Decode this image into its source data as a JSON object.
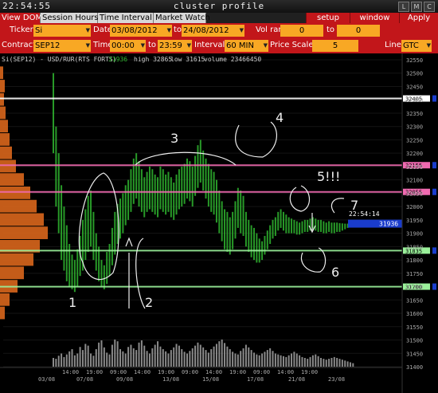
{
  "window": {
    "clock": "22:54:55",
    "title": "cluster profile",
    "buttons": [
      "L",
      "M",
      "C"
    ]
  },
  "menu": {
    "tabs": [
      "View DOM",
      "Session Hours",
      "Time Interval",
      "Market Watch"
    ],
    "active_tab": "View DOM",
    "setup_label": "setup",
    "window_label": "window",
    "apply_label": "Apply"
  },
  "controls": {
    "ticker_label": "Ticker",
    "ticker_value": "Si",
    "date_label": "Date",
    "date_from": "03/08/2012",
    "to_label": "to",
    "date_to": "24/08/2012",
    "vol_range_label": "Vol range",
    "vol_from": "0",
    "vol_to_label": "to",
    "vol_to": "0",
    "contract_label": "Contract",
    "contract_value": "SEP12",
    "time_label": "Time",
    "time_from": "00:00",
    "time_to_label": "to",
    "time_to": "23:59",
    "interval_label": "Interval",
    "interval_value": "60 MIN",
    "price_scale_label": "Price Scale",
    "price_scale_value": "5",
    "line_label": "Line",
    "line_value": "GTC"
  },
  "colors": {
    "accent_red": "#c2161a",
    "field_orange": "#f8a824",
    "profile_orange": "#d9661c",
    "cluster_green": "#2fb52f",
    "last_price_blue": "#1a3ccc"
  },
  "chart_data": {
    "type": "cluster",
    "instrument": "Si(SEP12) - USD/RUR(RTS FORTS)",
    "last": "31936",
    "high_text": "high 32865",
    "low_text": "low 31615",
    "volume_text": "volume 23466450",
    "last_time": "22:54:14",
    "last_price": 31936,
    "ylim": [
      31400,
      32550
    ],
    "y_ticks": [
      32550,
      32500,
      32450,
      32400,
      32350,
      32300,
      32250,
      32200,
      32150,
      32100,
      32050,
      32000,
      31950,
      31900,
      31850,
      31800,
      31750,
      31700,
      31650,
      31600,
      31550,
      31500,
      31450,
      31400
    ],
    "x_ticks_top": [
      "14:00",
      "19:00",
      "09:00",
      "14:00",
      "19:00",
      "09:00",
      "14:00",
      "19:00",
      "09:00",
      "14:00",
      "19:00"
    ],
    "x_ticks_bottom": [
      "03/08",
      "07/08",
      "09/08",
      "13/08",
      "15/08",
      "17/08",
      "21/08",
      "23/08"
    ],
    "levels": [
      {
        "price": 32405,
        "label": "32405",
        "color": "#ffffff"
      },
      {
        "price": 32155,
        "label": "32155",
        "color": "#f06ab0"
      },
      {
        "price": 32055,
        "label": "32055",
        "color": "#f06ab0"
      },
      {
        "price": 31835,
        "label": "31835",
        "color": "#9af09a"
      },
      {
        "price": 31700,
        "label": "31700",
        "color": "#9af09a"
      }
    ],
    "cluster_x": [
      0,
      3,
      6,
      9,
      12,
      15,
      18,
      21,
      24,
      27,
      30,
      33,
      36,
      39,
      42,
      45,
      48,
      51,
      54,
      57,
      60,
      63,
      66,
      69,
      72,
      75,
      78,
      81,
      84,
      87,
      90,
      93,
      96,
      99,
      102,
      105,
      108,
      111,
      114,
      117,
      120,
      123,
      126,
      129,
      132,
      135,
      138,
      141,
      144,
      147,
      150,
      153,
      156,
      159,
      162,
      165,
      168,
      171,
      174,
      177,
      180,
      183,
      186,
      189,
      192,
      195,
      198,
      201,
      204,
      207,
      210,
      213,
      216,
      219,
      222,
      225,
      228,
      231,
      234,
      237,
      240,
      243,
      246,
      249,
      252,
      255,
      258,
      261,
      264,
      267,
      270,
      273,
      276,
      279,
      282,
      285,
      288,
      291,
      294,
      297,
      300,
      303,
      306,
      309,
      312,
      315,
      318,
      321,
      324,
      327,
      330,
      333,
      336
    ],
    "cluster_highs": [
      32500,
      32300,
      32200,
      32080,
      32000,
      31930,
      31860,
      31820,
      31800,
      31840,
      31890,
      31950,
      31990,
      32040,
      32060,
      31980,
      31900,
      31850,
      31800,
      31780,
      31830,
      31860,
      31920,
      31980,
      32010,
      32030,
      32050,
      32080,
      32100,
      32140,
      32180,
      32200,
      32170,
      32140,
      32110,
      32130,
      32150,
      32140,
      32120,
      32110,
      32150,
      32140,
      32120,
      32130,
      32110,
      32090,
      32120,
      32140,
      32150,
      32160,
      32180,
      32170,
      32150,
      32190,
      32230,
      32250,
      32210,
      32180,
      32160,
      32140,
      32130,
      32100,
      32060,
      32020,
      31990,
      31980,
      31960,
      31980,
      32020,
      32070,
      32060,
      32040,
      31980,
      31950,
      31930,
      31920,
      31900,
      31880,
      31870,
      31890,
      31910,
      31930,
      31950,
      31960,
      31980,
      31990,
      31980,
      31970,
      31960,
      31955,
      31950,
      31945,
      31940,
      31945,
      31950,
      31950,
      31955,
      31960,
      31955,
      31950,
      31950,
      31945,
      31940,
      31945,
      31940,
      31940,
      31940,
      31938,
      31937,
      31936,
      31936,
      31936,
      31936
    ],
    "cluster_lows": [
      32200,
      32000,
      31900,
      31800,
      31760,
      31720,
      31700,
      31690,
      31680,
      31700,
      31740,
      31760,
      31800,
      31830,
      31850,
      31800,
      31760,
      31720,
      31700,
      31690,
      31710,
      31740,
      31780,
      31820,
      31860,
      31880,
      31900,
      31930,
      31950,
      31980,
      32010,
      32030,
      32000,
      31980,
      31960,
      31980,
      31990,
      31980,
      31970,
      31960,
      31990,
      31980,
      31970,
      31980,
      31960,
      31950,
      31970,
      31990,
      32000,
      32010,
      32030,
      32020,
      32000,
      32040,
      32070,
      32090,
      32060,
      32030,
      32000,
      31980,
      31970,
      31940,
      31900,
      31870,
      31840,
      31830,
      31820,
      31840,
      31880,
      31920,
      31900,
      31890,
      31850,
      31830,
      31810,
      31800,
      31790,
      31790,
      31800,
      31820,
      31840,
      31860,
      31880,
      31890,
      31910,
      31920,
      31910,
      31900,
      31900,
      31900,
      31900,
      31895,
      31895,
      31900,
      31905,
      31905,
      31910,
      31915,
      31910,
      31905,
      31905,
      31900,
      31900,
      31905,
      31900,
      31900,
      31905,
      31905,
      31910,
      31915,
      31920,
      31925,
      31930
    ],
    "volumes": [
      20,
      18,
      25,
      30,
      22,
      28,
      35,
      40,
      26,
      30,
      45,
      38,
      52,
      48,
      30,
      25,
      40,
      55,
      60,
      44,
      32,
      28,
      50,
      62,
      58,
      40,
      35,
      30,
      45,
      50,
      42,
      38,
      55,
      60,
      48,
      36,
      30,
      42,
      50,
      58,
      46,
      40,
      35,
      30,
      38,
      44,
      52,
      48,
      40,
      34,
      30,
      36,
      42,
      48,
      55,
      50,
      44,
      38,
      32,
      40,
      46,
      52,
      58,
      62,
      54,
      46,
      40,
      34,
      30,
      28,
      36,
      42,
      50,
      44,
      38,
      32,
      28,
      26,
      30,
      34,
      38,
      42,
      36,
      30,
      28,
      26,
      24,
      22,
      26,
      30,
      34,
      30,
      26,
      22,
      20,
      18,
      22,
      26,
      28,
      24,
      20,
      18,
      16,
      18,
      20,
      22,
      20,
      18,
      16,
      14,
      12,
      10,
      8
    ],
    "profile": [
      {
        "price": 32500,
        "w": 4
      },
      {
        "price": 32450,
        "w": 6
      },
      {
        "price": 32400,
        "w": 5
      },
      {
        "price": 32350,
        "w": 7
      },
      {
        "price": 32300,
        "w": 10
      },
      {
        "price": 32250,
        "w": 12
      },
      {
        "price": 32200,
        "w": 15
      },
      {
        "price": 32150,
        "w": 20
      },
      {
        "price": 32100,
        "w": 30
      },
      {
        "price": 32050,
        "w": 38
      },
      {
        "price": 32000,
        "w": 46
      },
      {
        "price": 31950,
        "w": 55
      },
      {
        "price": 31900,
        "w": 60
      },
      {
        "price": 31850,
        "w": 50
      },
      {
        "price": 31800,
        "w": 42
      },
      {
        "price": 31750,
        "w": 30
      },
      {
        "price": 31700,
        "w": 22
      },
      {
        "price": 31650,
        "w": 12
      },
      {
        "price": 31600,
        "w": 6
      }
    ],
    "annotations": [
      "1",
      "2",
      "3",
      "4",
      "5!!!",
      "6",
      "7"
    ]
  }
}
